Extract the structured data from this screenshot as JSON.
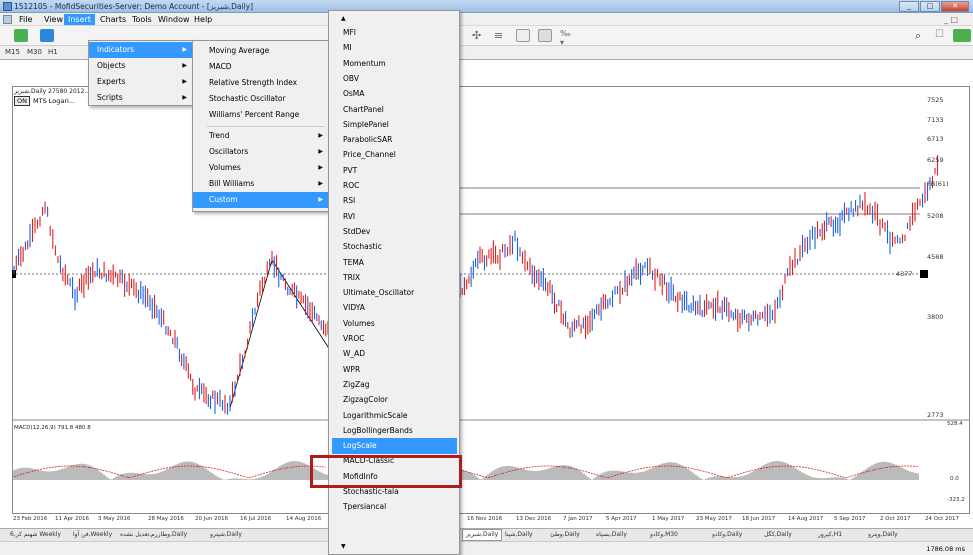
{
  "window": {
    "title": "1512105 - MofidSecurities-Server: Demo Account - [شبریز,Daily]",
    "buttons": [
      "_",
      "□",
      "✕"
    ]
  },
  "menubar": {
    "items": [
      "File",
      "View",
      "Insert",
      "Charts",
      "Tools",
      "Window",
      "Help"
    ],
    "active": "Insert",
    "right": "_ □"
  },
  "timeframes": [
    "M15",
    "M30",
    "H1"
  ],
  "chart": {
    "symbol_line": "شبریز,Daily 27580 2012...",
    "ea_badge": "ON",
    "ea_name": "MTS Logari...",
    "macd_label": "MACD(12,26,9) 791.8 480.8",
    "price_labels": [
      "7525",
      "7133",
      "6713",
      "6259",
      "FB(61)",
      "5208",
      "4568",
      "4377",
      "3800",
      "2773"
    ],
    "macd_scale": [
      "528.4",
      "0.0",
      "-323.2"
    ],
    "time_labels": [
      "23 Feb 2016",
      "11 Apr 2016",
      "3 May 2016",
      "28 May 2016",
      "20 Jun 2016",
      "16 Jul 2016",
      "14 Aug 2016",
      "16 Nov 2016",
      "13 Dec 2016",
      "7 Jan 2017",
      "5 Apr 2017",
      "1 May 2017",
      "23 May 2017",
      "18 Jun 2017",
      "14 Aug 2017",
      "5 Sep 2017",
      "2 Oct 2017",
      "24 Oct 2017"
    ]
  },
  "insert_menu": {
    "items": [
      {
        "label": "Indicators",
        "submenu": true,
        "highlight": true
      },
      {
        "label": "Objects",
        "submenu": true
      },
      {
        "label": "Experts",
        "submenu": true
      },
      {
        "label": "Scripts",
        "submenu": true
      }
    ]
  },
  "indicators_menu": {
    "items": [
      "Moving Average",
      "MACD",
      "Relative Strength Index",
      "Stochastic Oscillator",
      "Williams' Percent Range"
    ],
    "groups": [
      "Trend",
      "Oscillators",
      "Volumes",
      "Bill Williams",
      "Custom"
    ],
    "highlight": "Custom"
  },
  "custom_menu": {
    "top_arrow": "▲",
    "items": [
      "MFI",
      "MI",
      "Momentum",
      "OBV",
      "OsMA",
      "ChartPanel",
      "SimplePanel",
      "ParabolicSAR",
      "Price_Channel",
      "PVT",
      "ROC",
      "RSI",
      "RVI",
      "StdDev",
      "Stochastic",
      "TEMA",
      "TRIX",
      "Ultimate_Oscillator",
      "VIDYA",
      "Volumes",
      "VROC",
      "W_AD",
      "WPR",
      "ZigZag",
      "ZigzagColor",
      "LogarithmicScale",
      "LogBollingerBands",
      "LogScale",
      "MACD-Classic",
      "MofidInfo",
      "Stochastic-tala",
      "Tpersiancal"
    ],
    "highlight": "LogScale",
    "bottom_arrow": "▼"
  },
  "bottom_tabs": [
    "شهنم کر,6 Weekly",
    "فن آوا,Weekly",
    "وطازرم,تعدیل نشده,Daily",
    "شپترو,Daily",
    "شبریز,Daily",
    "شپنا,Daily",
    "وطئ,Daily",
    "بسپاه,Daily",
    "وکادو,M30",
    "وکادو,Daily",
    "کگل,Daily",
    "کپرور,H1",
    "وپترو,Daily"
  ],
  "active_tab": "شبریز,Daily",
  "status": {
    "ping": "1786.08 ms"
  },
  "colors": {
    "menu_highlight": "#3399ff",
    "bear": "#e02020",
    "bull": "#2060e0",
    "callout": "#b01c1c"
  }
}
